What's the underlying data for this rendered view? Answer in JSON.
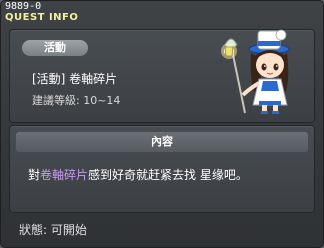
{
  "window": {
    "id_label": "9889-0",
    "title": "QUEST INFO"
  },
  "quest": {
    "tag": "活動",
    "name": "[活動] 卷軸碎片",
    "level": "建議等級: 10~14",
    "npc": "npc-girl-with-lantern-staff"
  },
  "content": {
    "header": "內容",
    "text_before": "對",
    "text_highlight": "卷軸碎片",
    "text_after": "感到好奇就赶紧去找 星缘吧。"
  },
  "status": {
    "label": "狀態: 可開始"
  },
  "colors": {
    "title": "#f5f0a0",
    "highlight": "#c89cf0",
    "panel": "#43474b"
  }
}
